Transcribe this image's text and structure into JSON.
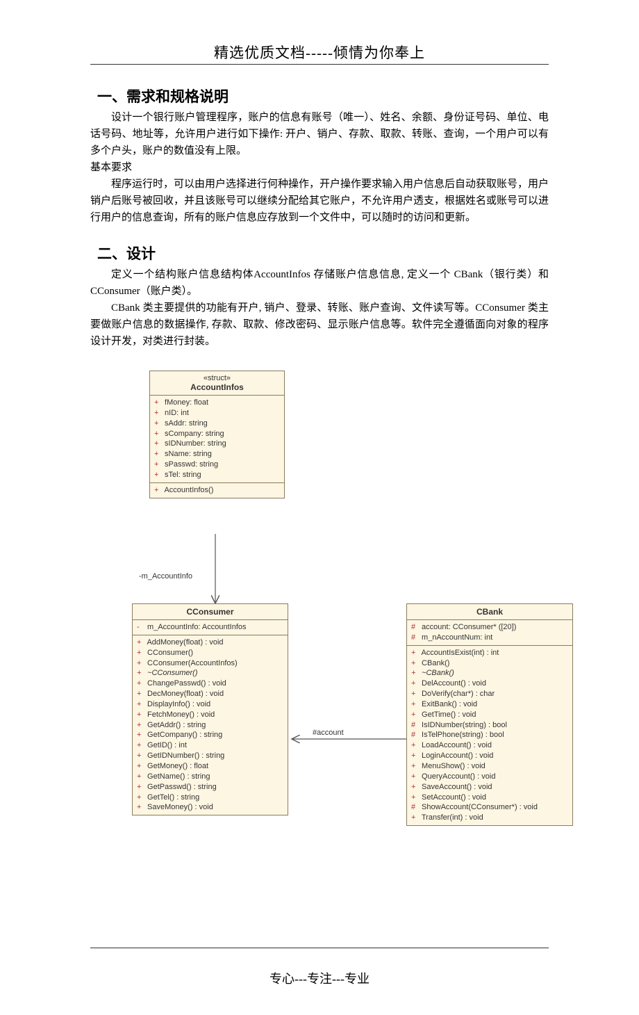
{
  "header": "精选优质文档-----倾情为你奉上",
  "footer": "专心---专注---专业",
  "section1": {
    "title": "一、需求和规格说明",
    "p1": "设计一个银行账户管理程序，账户的信息有账号（唯一）、姓名、余额、身份证号码、单位、电话号码、地址等，允许用户进行如下操作: 开户、销户、存款、取款、转账、查询，一个用户可以有多个户头，账户的数值没有上限。",
    "p2": "基本要求",
    "p3": "程序运行时，可以由用户选择进行何种操作，开户操作要求输入用户信息后自动获取账号，用户销户后账号被回收，并且该账号可以继续分配给其它账户，不允许用户透支，根据姓名或账号可以进行用户的信息查询，所有的账户信息应存放到一个文件中，可以随时的访问和更新。"
  },
  "section2": {
    "title": "二、设计",
    "p1": "定义一个结构账户信息结构体AccountInfos 存储账户信息信息, 定义一个 CBank（银行类）和 CConsumer（账户类）。",
    "p2": "CBank 类主要提供的功能有开户, 销户、登录、转账、账户查询、文件读写等。CConsumer 类主要做账户信息的数据操作, 存款、取款、修改密码、显示账户信息等。软件完全遵循面向对象的程序设计开发，对类进行封装。"
  },
  "uml": {
    "struct": {
      "stereo": "«struct»",
      "name": "AccountInfos",
      "attrs": [
        {
          "vis": "+",
          "text": "fMoney:  float"
        },
        {
          "vis": "+",
          "text": "nID:  int"
        },
        {
          "vis": "+",
          "text": "sAddr:  string"
        },
        {
          "vis": "+",
          "text": "sCompany:  string"
        },
        {
          "vis": "+",
          "text": "sIDNumber:  string"
        },
        {
          "vis": "+",
          "text": "sName:  string"
        },
        {
          "vis": "+",
          "text": "sPasswd:  string"
        },
        {
          "vis": "+",
          "text": "sTel:  string"
        }
      ],
      "ops": [
        {
          "vis": "+",
          "text": "AccountInfos()"
        }
      ]
    },
    "consumer": {
      "name": "CConsumer",
      "attrs": [
        {
          "vis": "-",
          "text": "m_AccountInfo:  AccountInfos"
        }
      ],
      "ops": [
        {
          "vis": "+",
          "text": "AddMoney(float) : void"
        },
        {
          "vis": "+",
          "text": "CConsumer()"
        },
        {
          "vis": "+",
          "text": "CConsumer(AccountInfos)"
        },
        {
          "vis": "+",
          "text": "~CConsumer()",
          "italic": true
        },
        {
          "vis": "+",
          "text": "ChangePasswd() : void"
        },
        {
          "vis": "+",
          "text": "DecMoney(float) : void"
        },
        {
          "vis": "+",
          "text": "DisplayInfo() : void"
        },
        {
          "vis": "+",
          "text": "FetchMoney() : void"
        },
        {
          "vis": "+",
          "text": "GetAddr() : string"
        },
        {
          "vis": "+",
          "text": "GetCompany() : string"
        },
        {
          "vis": "+",
          "text": "GetID() : int"
        },
        {
          "vis": "+",
          "text": "GetIDNumber() : string"
        },
        {
          "vis": "+",
          "text": "GetMoney() : float"
        },
        {
          "vis": "+",
          "text": "GetName() : string"
        },
        {
          "vis": "+",
          "text": "GetPasswd() : string"
        },
        {
          "vis": "+",
          "text": "GetTel() : string"
        },
        {
          "vis": "+",
          "text": "SaveMoney() : void"
        }
      ]
    },
    "bank": {
      "name": "CBank",
      "attrs": [
        {
          "vis": "#",
          "text": "account:  CConsumer* ([20])"
        },
        {
          "vis": "#",
          "text": "m_nAccountNum:  int"
        }
      ],
      "ops": [
        {
          "vis": "+",
          "text": "AccountIsExist(int) : int"
        },
        {
          "vis": "+",
          "text": "CBank()"
        },
        {
          "vis": "+",
          "text": "~CBank()",
          "italic": true
        },
        {
          "vis": "+",
          "text": "DelAccount() : void"
        },
        {
          "vis": "+",
          "text": "DoVerify(char*) : char"
        },
        {
          "vis": "+",
          "text": "ExitBank() : void"
        },
        {
          "vis": "+",
          "text": "GetTime() : void"
        },
        {
          "vis": "#",
          "text": "IsIDNumber(string) : bool"
        },
        {
          "vis": "#",
          "text": "IsTelPhone(string) : bool"
        },
        {
          "vis": "+",
          "text": "LoadAccount() : void"
        },
        {
          "vis": "+",
          "text": "LoginAccount() : void"
        },
        {
          "vis": "+",
          "text": "MenuShow() : void"
        },
        {
          "vis": "+",
          "text": "QueryAccount() : void"
        },
        {
          "vis": "+",
          "text": "SaveAccount() : void"
        },
        {
          "vis": "+",
          "text": "SetAccount() : void"
        },
        {
          "vis": "#",
          "text": "ShowAccount(CConsumer*) : void"
        },
        {
          "vis": "+",
          "text": "Transfer(int) : void"
        }
      ]
    },
    "label_mAccount": "-m_AccountInfo",
    "label_account": "#account"
  }
}
